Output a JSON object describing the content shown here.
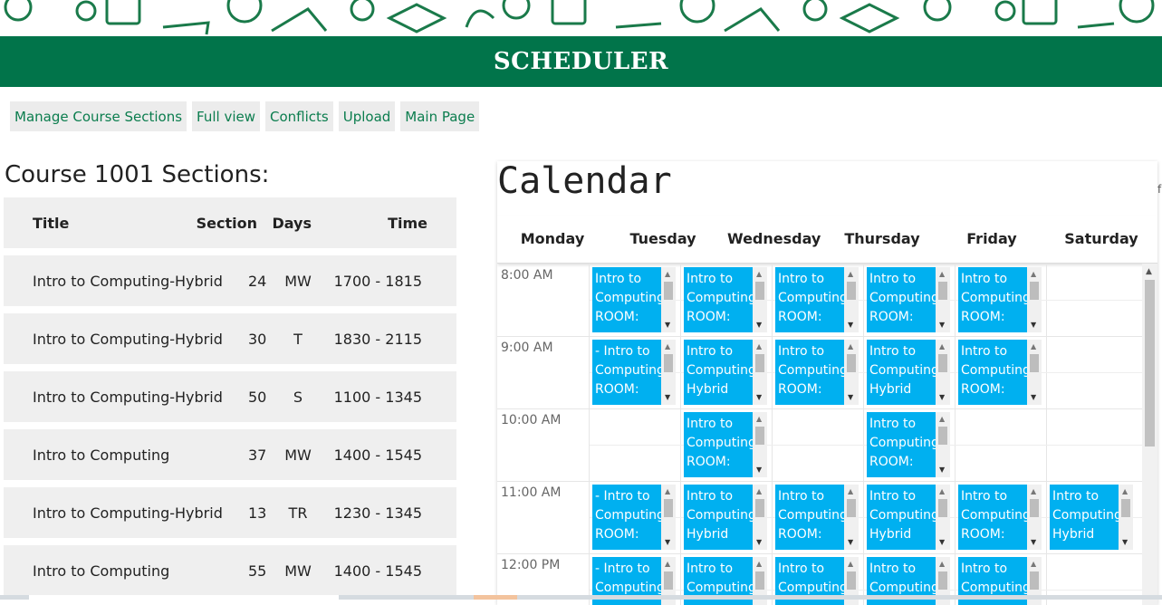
{
  "header": {
    "title": "SCHEDULER"
  },
  "nav": [
    {
      "label": "Manage Course Sections"
    },
    {
      "label": "Full view"
    },
    {
      "label": "Conflicts"
    },
    {
      "label": "Upload"
    },
    {
      "label": "Main Page"
    }
  ],
  "sections": {
    "heading": "Course 1001 Sections:",
    "columns": [
      "Title",
      "Section",
      "Days",
      "Time"
    ],
    "rows": [
      {
        "title": "Intro to Computing-Hybrid",
        "section": "24",
        "days": "MW",
        "time": "1700 - 1815"
      },
      {
        "title": "Intro to Computing-Hybrid",
        "section": "30",
        "days": "T",
        "time": "1830 - 2115"
      },
      {
        "title": "Intro to Computing-Hybrid",
        "section": "50",
        "days": "S",
        "time": "1100 - 1345"
      },
      {
        "title": "Intro to Computing",
        "section": "37",
        "days": "MW",
        "time": "1400 - 1545"
      },
      {
        "title": "Intro to Computing-Hybrid",
        "section": "13",
        "days": "TR",
        "time": "1230 - 1345"
      },
      {
        "title": "Intro to Computing",
        "section": "55",
        "days": "MW",
        "time": "1400 - 1545"
      }
    ]
  },
  "calendar": {
    "title": "Calendar",
    "days": [
      "Monday",
      "Tuesday",
      "Wednesday",
      "Thursday",
      "Friday",
      "Saturday"
    ],
    "times": [
      "8:00 AM",
      "9:00 AM",
      "10:00 AM",
      "11:00 AM",
      "12:00 PM"
    ],
    "edge_char": "f",
    "events": [
      {
        "day": 0,
        "slot": 0,
        "text": "Intro to\nComputing\nROOM:"
      },
      {
        "day": 1,
        "slot": 0,
        "text": "Intro to\nComputing\nROOM:"
      },
      {
        "day": 2,
        "slot": 0,
        "text": "Intro to\nComputing\nROOM:"
      },
      {
        "day": 3,
        "slot": 0,
        "text": "Intro to\nComputing\nROOM:"
      },
      {
        "day": 4,
        "slot": 0,
        "text": "Intro to\nComputing\nROOM:"
      },
      {
        "day": 0,
        "slot": 1,
        "text": "- Intro to\nComputing\nROOM:"
      },
      {
        "day": 1,
        "slot": 1,
        "text": "Intro to\nComputing-\nHybrid"
      },
      {
        "day": 2,
        "slot": 1,
        "text": "Intro to\nComputing\nROOM:"
      },
      {
        "day": 3,
        "slot": 1,
        "text": "Intro to\nComputing-\nHybrid"
      },
      {
        "day": 4,
        "slot": 1,
        "text": "Intro to\nComputing\nROOM:"
      },
      {
        "day": 1,
        "slot": 2,
        "text": "Intro to\nComputing\nROOM:"
      },
      {
        "day": 3,
        "slot": 2,
        "text": "Intro to\nComputing\nROOM:"
      },
      {
        "day": 0,
        "slot": 3,
        "text": "- Intro to\nComputing\nROOM:"
      },
      {
        "day": 1,
        "slot": 3,
        "text": "Intro to\nComputing-\nHybrid"
      },
      {
        "day": 2,
        "slot": 3,
        "text": "Intro to\nComputing\nROOM:"
      },
      {
        "day": 3,
        "slot": 3,
        "text": "Intro to\nComputing-\nHybrid"
      },
      {
        "day": 4,
        "slot": 3,
        "text": "Intro to\nComputing\nROOM:"
      },
      {
        "day": 5,
        "slot": 3,
        "text": "Intro to\nComputing-\nHybrid"
      },
      {
        "day": 0,
        "slot": 4,
        "text": "- Intro to\nComputing"
      },
      {
        "day": 1,
        "slot": 4,
        "text": "Intro to\nComputing-"
      },
      {
        "day": 2,
        "slot": 4,
        "text": "Intro to\nComputing"
      },
      {
        "day": 3,
        "slot": 4,
        "text": "Intro to\nComputing-"
      },
      {
        "day": 4,
        "slot": 4,
        "text": "Intro to\nComputing"
      }
    ]
  },
  "colors": {
    "brand_green": "#01744a",
    "event_blue": "#00b0f0",
    "nav_text": "#0b7d4e"
  }
}
